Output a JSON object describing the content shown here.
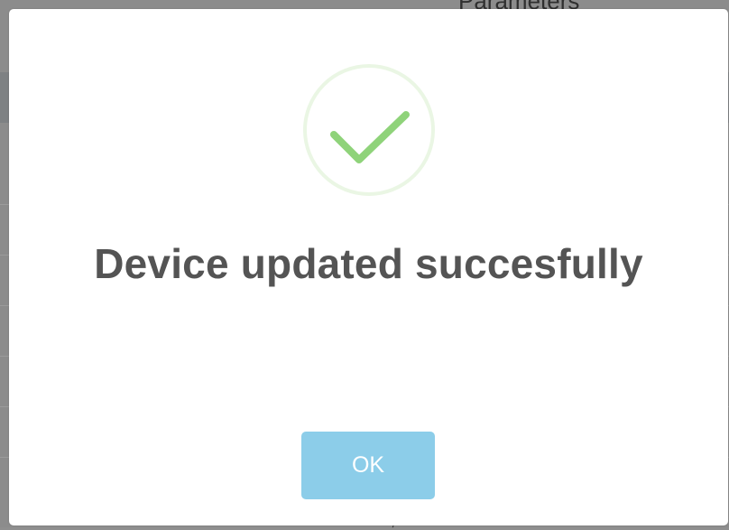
{
  "background": {
    "heading": "Parameters"
  },
  "dialog": {
    "icon": "success-check-icon",
    "title": "Device updated succesfully",
    "ok_label": "OK"
  },
  "colors": {
    "check": "#8fd37a",
    "ring": "#eaf6e4",
    "title": "#545454",
    "button": "#8ccde9",
    "button_text": "#ffffff"
  }
}
